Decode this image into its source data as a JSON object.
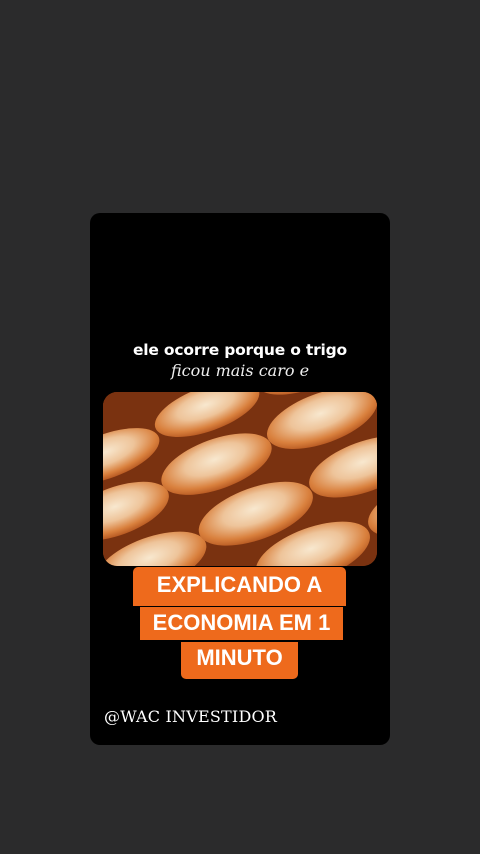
{
  "story": {
    "caption_line1": "ele ocorre porque o trigo",
    "caption_line2": "ficou mais caro e",
    "title_line1": "EXPLICANDO A",
    "title_line2": "ECONOMIA EM 1",
    "title_line3": "MINUTO",
    "handle": "@WAC INVESTIDOR"
  },
  "colors": {
    "background": "#2b2b2c",
    "card": "#000000",
    "accent": "#ee6a1c"
  }
}
